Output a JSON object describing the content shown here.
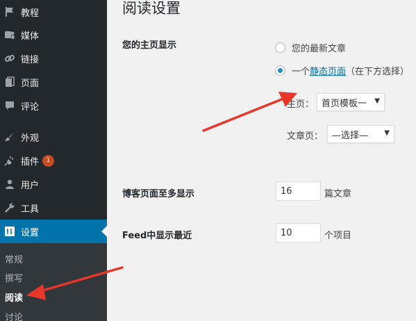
{
  "sidebar": {
    "items": [
      {
        "label": "教程",
        "icon": "flag-icon"
      },
      {
        "label": "媒体",
        "icon": "media-icon"
      },
      {
        "label": "链接",
        "icon": "link-icon"
      },
      {
        "label": "页面",
        "icon": "page-icon"
      },
      {
        "label": "评论",
        "icon": "comment-icon"
      },
      {
        "label": "外观",
        "icon": "paintbrush-icon"
      },
      {
        "label": "插件",
        "icon": "plugin-icon",
        "badge": "1"
      },
      {
        "label": "用户",
        "icon": "user-icon"
      },
      {
        "label": "工具",
        "icon": "wrench-icon"
      },
      {
        "label": "设置",
        "icon": "settings-icon",
        "active": true
      }
    ],
    "submenu": [
      "常规",
      "撰写",
      "阅读",
      "讨论"
    ],
    "current_submenu": "阅读"
  },
  "main": {
    "title": "阅读设置",
    "front_page": {
      "label": "您的主页显示",
      "option_latest": "您的最新文章",
      "option_static_prefix": "一个",
      "option_static_link": "静态页面",
      "option_static_suffix": "（在下方选择）",
      "selected": "static",
      "homepage_label": "主页：",
      "homepage_value": "首页模板一",
      "postspage_label": "文章页：",
      "postspage_value": "—选择—"
    },
    "posts_per_page": {
      "label": "博客页面至多显示",
      "value": "16",
      "unit": "篇文章"
    },
    "feed_items": {
      "label": "Feed中显示最近",
      "value": "10",
      "unit": "个项目"
    }
  },
  "colors": {
    "sidebar_bg": "#23282d",
    "submenu_bg": "#32373c",
    "active_bg": "#0073aa",
    "badge": "#ca4a1f",
    "annotation_arrow": "#e8372a"
  }
}
